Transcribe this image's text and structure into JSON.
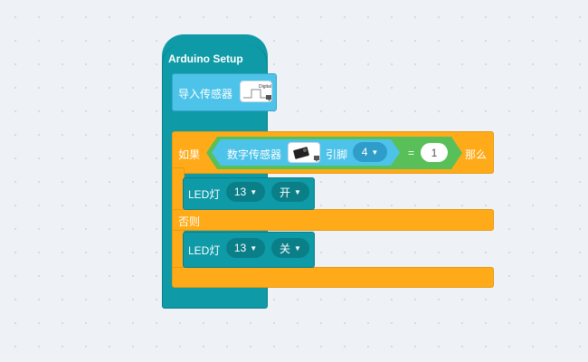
{
  "setup_block": {
    "title": "Arduino Setup"
  },
  "import_block": {
    "label": "导入传感器",
    "sensor_icon": "digital-sensor-icon",
    "sensor_icon_text": "Digital"
  },
  "if_block": {
    "if_label": "如果",
    "then_label": "那么",
    "else_label": "否则",
    "condition": {
      "sensor_label": "数字传感器",
      "sensor_icon": "sensor-module-icon",
      "pin_label": "引脚",
      "pin_value": "4",
      "operator": "=",
      "compare_value": "1"
    }
  },
  "led_on_block": {
    "label": "LED灯",
    "pin": "13",
    "state": "开"
  },
  "led_off_block": {
    "label": "LED灯",
    "pin": "13",
    "state": "关"
  },
  "colors": {
    "setup": "#0e9aa7",
    "sensor": "#4dc3ea",
    "control": "#ffab19",
    "operator": "#59c059"
  }
}
